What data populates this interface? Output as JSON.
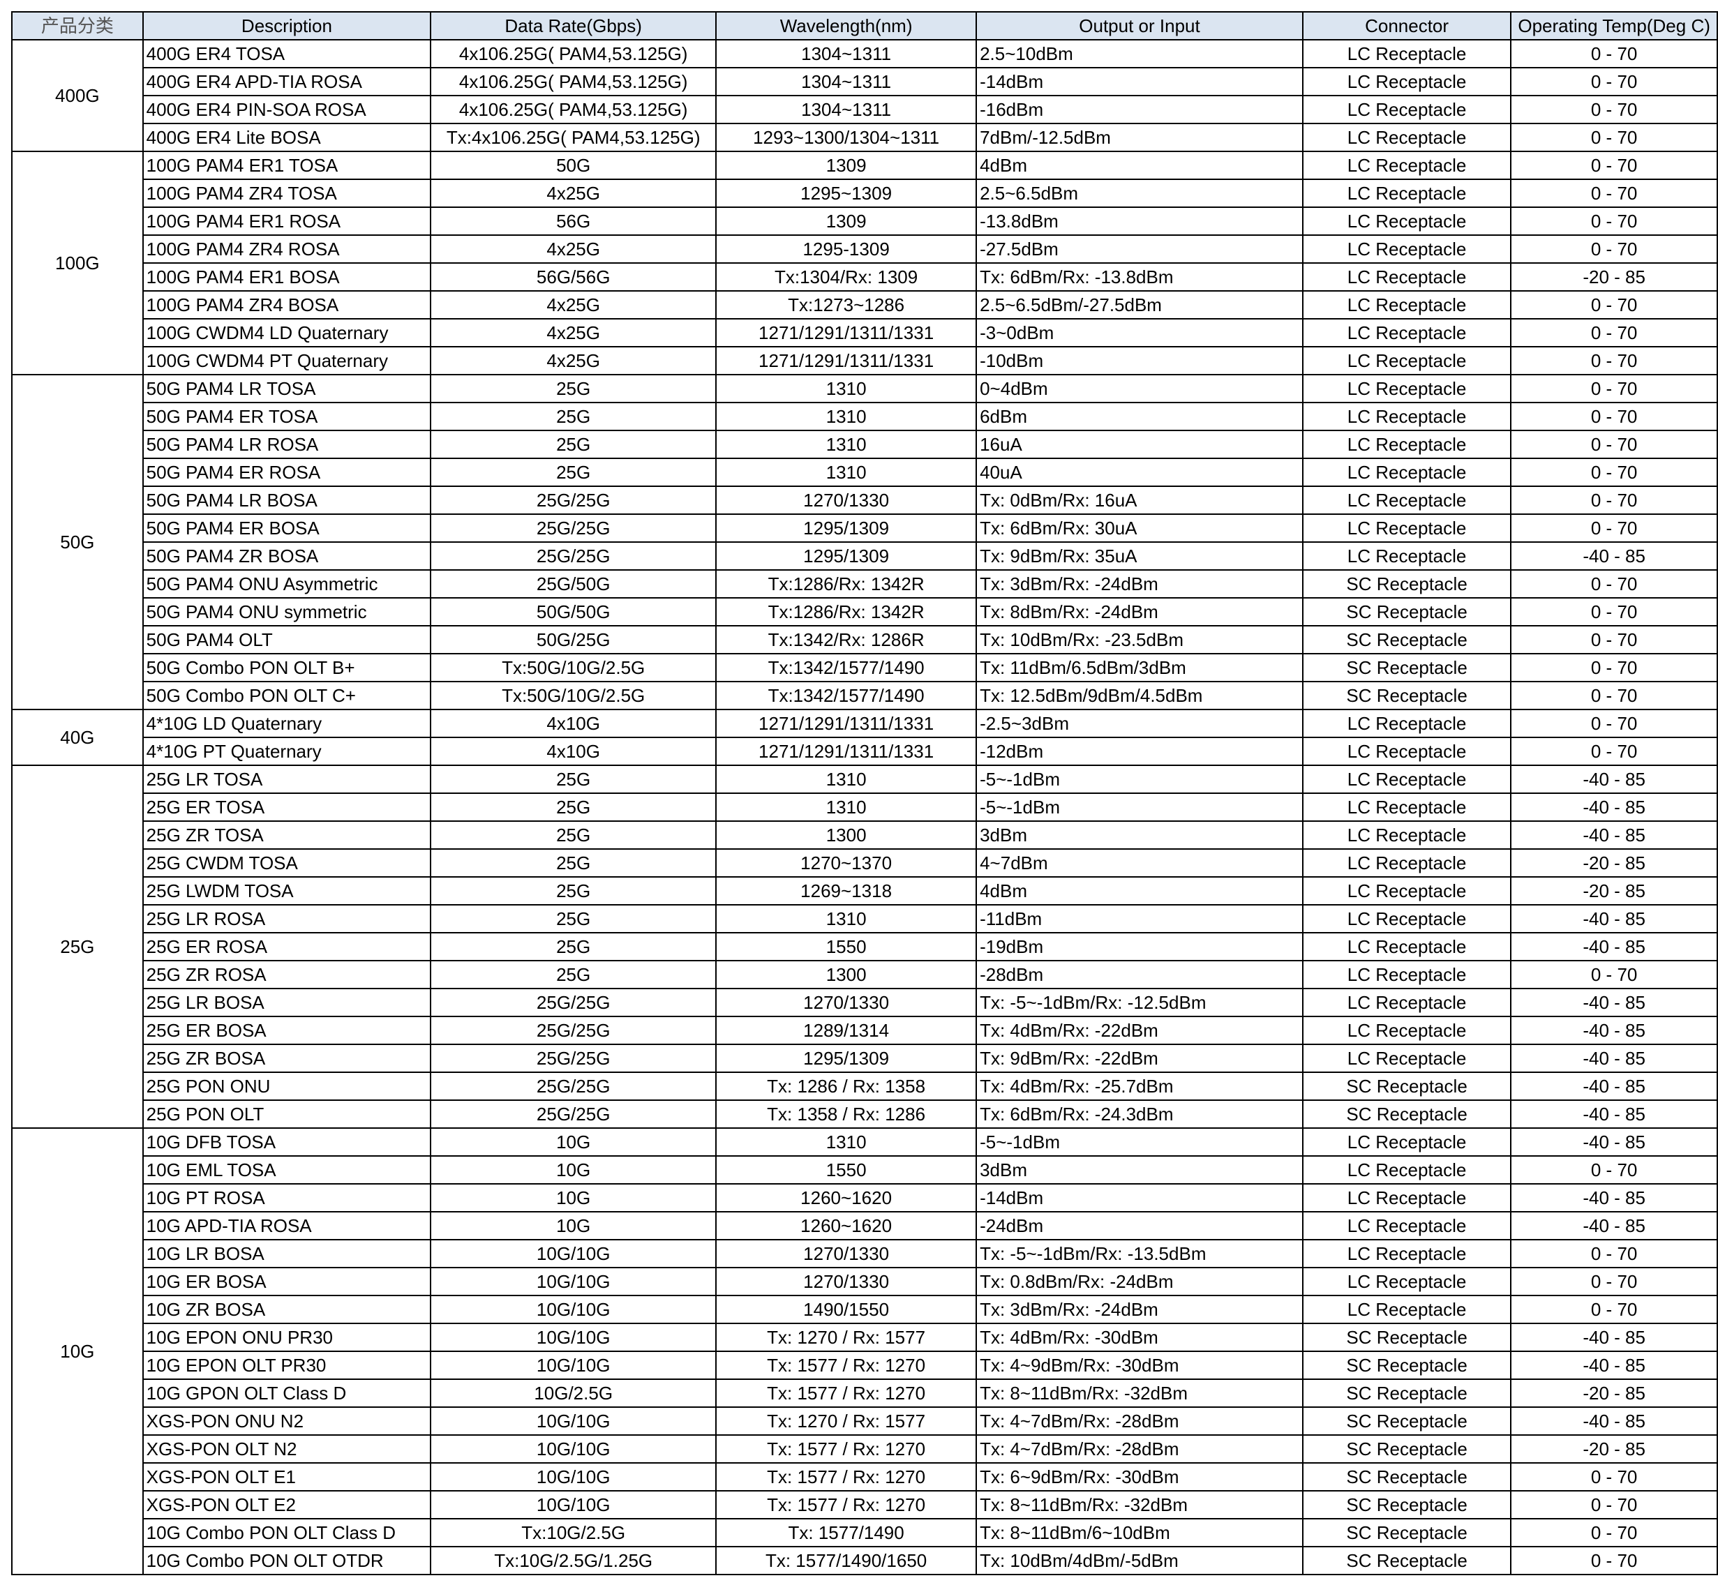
{
  "columns": [
    {
      "key": "category",
      "label": "产品分类"
    },
    {
      "key": "description",
      "label": "Description"
    },
    {
      "key": "data_rate",
      "label": "Data Rate(Gbps)"
    },
    {
      "key": "wavelength",
      "label": "Wavelength(nm)"
    },
    {
      "key": "output_input",
      "label": "Output or Input"
    },
    {
      "key": "connector",
      "label": "Connector"
    },
    {
      "key": "temp",
      "label": "Operating Temp(Deg C)"
    }
  ],
  "groups": [
    {
      "category": "400G",
      "rows": [
        [
          "400G ER4 TOSA",
          "4x106.25G( PAM4,53.125G)",
          "1304~1311",
          "2.5~10dBm",
          "LC Receptacle",
          "0 - 70"
        ],
        [
          "400G ER4 APD-TIA ROSA",
          "4x106.25G( PAM4,53.125G)",
          "1304~1311",
          "-14dBm",
          "LC Receptacle",
          "0 - 70"
        ],
        [
          "400G ER4 PIN-SOA ROSA",
          "4x106.25G( PAM4,53.125G)",
          "1304~1311",
          "-16dBm",
          "LC Receptacle",
          "0 - 70"
        ],
        [
          "400G ER4 Lite BOSA",
          "Tx:4x106.25G( PAM4,53.125G)",
          "1293~1300/1304~1311",
          "7dBm/-12.5dBm",
          "LC Receptacle",
          "0 - 70"
        ]
      ]
    },
    {
      "category": "100G",
      "rows": [
        [
          "100G PAM4 ER1 TOSA",
          "50G",
          "1309",
          "4dBm",
          "LC Receptacle",
          "0 - 70"
        ],
        [
          "100G PAM4 ZR4 TOSA",
          "4x25G",
          "1295~1309",
          "2.5~6.5dBm",
          "LC Receptacle",
          "0 - 70"
        ],
        [
          "100G PAM4 ER1 ROSA",
          "56G",
          "1309",
          "-13.8dBm",
          "LC Receptacle",
          "0 - 70"
        ],
        [
          "100G PAM4 ZR4 ROSA",
          "4x25G",
          "1295-1309",
          "-27.5dBm",
          "LC Receptacle",
          "0 - 70"
        ],
        [
          "100G PAM4 ER1 BOSA",
          "56G/56G",
          "Tx:1304/Rx: 1309",
          "Tx: 6dBm/Rx: -13.8dBm",
          "LC Receptacle",
          "-20 - 85"
        ],
        [
          "100G PAM4 ZR4 BOSA",
          "4x25G",
          "Tx:1273~1286",
          "2.5~6.5dBm/-27.5dBm",
          "LC Receptacle",
          "0 - 70"
        ],
        [
          "100G CWDM4 LD Quaternary",
          "4x25G",
          "1271/1291/1311/1331",
          "-3~0dBm",
          "LC Receptacle",
          "0 - 70"
        ],
        [
          "100G CWDM4 PT Quaternary",
          "4x25G",
          "1271/1291/1311/1331",
          "-10dBm",
          "LC Receptacle",
          "0 - 70"
        ]
      ]
    },
    {
      "category": "50G",
      "rows": [
        [
          "50G PAM4 LR TOSA",
          "25G",
          "1310",
          "0~4dBm",
          "LC Receptacle",
          "0 - 70"
        ],
        [
          "50G PAM4 ER TOSA",
          "25G",
          "1310",
          "6dBm",
          "LC Receptacle",
          "0 - 70"
        ],
        [
          "50G PAM4 LR ROSA",
          "25G",
          "1310",
          "16uA",
          "LC Receptacle",
          "0 - 70"
        ],
        [
          "50G PAM4 ER ROSA",
          "25G",
          "1310",
          "40uA",
          "LC Receptacle",
          "0 - 70"
        ],
        [
          "50G PAM4 LR BOSA",
          "25G/25G",
          "1270/1330",
          "Tx: 0dBm/Rx: 16uA",
          "LC Receptacle",
          "0 - 70"
        ],
        [
          "50G PAM4 ER BOSA",
          "25G/25G",
          "1295/1309",
          "Tx: 6dBm/Rx: 30uA",
          "LC Receptacle",
          "0 - 70"
        ],
        [
          "50G PAM4 ZR BOSA",
          "25G/25G",
          "1295/1309",
          "Tx: 9dBm/Rx: 35uA",
          "LC Receptacle",
          "-40 - 85"
        ],
        [
          "50G PAM4 ONU Asymmetric",
          "25G/50G",
          "Tx:1286/Rx: 1342R",
          "Tx: 3dBm/Rx: -24dBm",
          "SC Receptacle",
          "0 - 70"
        ],
        [
          "50G PAM4 ONU symmetric",
          "50G/50G",
          "Tx:1286/Rx: 1342R",
          "Tx: 8dBm/Rx: -24dBm",
          "SC Receptacle",
          "0 - 70"
        ],
        [
          "50G PAM4 OLT",
          "50G/25G",
          "Tx:1342/Rx: 1286R",
          "Tx: 10dBm/Rx: -23.5dBm",
          "SC Receptacle",
          "0 - 70"
        ],
        [
          "50G Combo PON OLT  B+",
          "Tx:50G/10G/2.5G",
          "Tx:1342/1577/1490",
          "Tx: 11dBm/6.5dBm/3dBm",
          "SC Receptacle",
          "0 - 70"
        ],
        [
          "50G Combo PON OLT  C+",
          "Tx:50G/10G/2.5G",
          "Tx:1342/1577/1490",
          "Tx: 12.5dBm/9dBm/4.5dBm",
          "SC Receptacle",
          "0 - 70"
        ]
      ]
    },
    {
      "category": "40G",
      "rows": [
        [
          "4*10G LD Quaternary",
          "4x10G",
          "1271/1291/1311/1331",
          "-2.5~3dBm",
          "LC Receptacle",
          "0 - 70"
        ],
        [
          "4*10G PT Quaternary",
          "4x10G",
          "1271/1291/1311/1331",
          "-12dBm",
          "LC Receptacle",
          "0 - 70"
        ]
      ]
    },
    {
      "category": "25G",
      "rows": [
        [
          "25G LR TOSA",
          "25G",
          "1310",
          "-5~-1dBm",
          "LC Receptacle",
          "-40 - 85"
        ],
        [
          "25G ER TOSA",
          "25G",
          "1310",
          "-5~-1dBm",
          "LC Receptacle",
          "-40 - 85"
        ],
        [
          "25G ZR TOSA",
          "25G",
          "1300",
          "3dBm",
          "LC Receptacle",
          "-40 - 85"
        ],
        [
          "25G CWDM TOSA",
          "25G",
          "1270~1370",
          "4~7dBm",
          "LC Receptacle",
          "-20 - 85"
        ],
        [
          "25G LWDM TOSA",
          "25G",
          "1269~1318",
          "4dBm",
          "LC Receptacle",
          "-20 - 85"
        ],
        [
          "25G LR ROSA",
          "25G",
          "1310",
          "-11dBm",
          "LC Receptacle",
          "-40 - 85"
        ],
        [
          "25G ER ROSA",
          "25G",
          "1550",
          "-19dBm",
          "LC Receptacle",
          "-40 - 85"
        ],
        [
          "25G ZR ROSA",
          "25G",
          "1300",
          "-28dBm",
          "LC Receptacle",
          "0 - 70"
        ],
        [
          "25G LR BOSA",
          "25G/25G",
          "1270/1330",
          "Tx: -5~-1dBm/Rx: -12.5dBm",
          "LC Receptacle",
          "-40 - 85"
        ],
        [
          "25G ER BOSA",
          "25G/25G",
          "1289/1314",
          "Tx: 4dBm/Rx: -22dBm",
          "LC Receptacle",
          "-40 - 85"
        ],
        [
          "25G ZR BOSA",
          "25G/25G",
          "1295/1309",
          "Tx: 9dBm/Rx: -22dBm",
          "LC Receptacle",
          "-40 - 85"
        ],
        [
          "25G PON ONU",
          "25G/25G",
          "Tx: 1286 / Rx: 1358",
          "Tx: 4dBm/Rx: -25.7dBm",
          "SC Receptacle",
          "-40 - 85"
        ],
        [
          "25G PON OLT",
          "25G/25G",
          "Tx: 1358 / Rx: 1286",
          "Tx: 6dBm/Rx: -24.3dBm",
          "SC Receptacle",
          "-40 - 85"
        ]
      ]
    },
    {
      "category": "10G",
      "rows": [
        [
          "10G DFB TOSA",
          "10G",
          "1310",
          "-5~-1dBm",
          "LC Receptacle",
          "-40 - 85"
        ],
        [
          "10G EML TOSA",
          "10G",
          "1550",
          "3dBm",
          "LC Receptacle",
          "0 - 70"
        ],
        [
          "10G PT ROSA",
          "10G",
          "1260~1620",
          "-14dBm",
          "LC Receptacle",
          "-40 - 85"
        ],
        [
          "10G APD-TIA ROSA",
          "10G",
          "1260~1620",
          "-24dBm",
          "LC Receptacle",
          "-40 - 85"
        ],
        [
          "10G LR BOSA",
          "10G/10G",
          "1270/1330",
          "Tx: -5~-1dBm/Rx: -13.5dBm",
          "LC Receptacle",
          "0 - 70"
        ],
        [
          "10G ER BOSA",
          "10G/10G",
          "1270/1330",
          "Tx: 0.8dBm/Rx: -24dBm",
          "LC Receptacle",
          "0 - 70"
        ],
        [
          "10G ZR BOSA",
          "10G/10G",
          "1490/1550",
          "Tx: 3dBm/Rx: -24dBm",
          "LC Receptacle",
          "0 - 70"
        ],
        [
          "10G EPON ONU PR30",
          "10G/10G",
          "Tx: 1270 / Rx: 1577",
          "Tx: 4dBm/Rx: -30dBm",
          "SC Receptacle",
          "-40 - 85"
        ],
        [
          "10G EPON OLT PR30",
          "10G/10G",
          "Tx: 1577 / Rx: 1270",
          "Tx: 4~9dBm/Rx: -30dBm",
          "SC Receptacle",
          "-40 - 85"
        ],
        [
          "10G GPON OLT Class D",
          "10G/2.5G",
          "Tx: 1577 / Rx: 1270",
          "Tx: 8~11dBm/Rx: -32dBm",
          "SC Receptacle",
          "-20 - 85"
        ],
        [
          "XGS-PON ONU N2",
          "10G/10G",
          "Tx: 1270 / Rx: 1577",
          "Tx: 4~7dBm/Rx: -28dBm",
          "SC Receptacle",
          "-40 - 85"
        ],
        [
          "XGS-PON OLT N2",
          "10G/10G",
          "Tx: 1577 / Rx: 1270",
          "Tx: 4~7dBm/Rx: -28dBm",
          "SC Receptacle",
          "-20 - 85"
        ],
        [
          "XGS-PON OLT E1",
          "10G/10G",
          "Tx: 1577 / Rx: 1270",
          "Tx: 6~9dBm/Rx: -30dBm",
          "SC Receptacle",
          "0 - 70"
        ],
        [
          "XGS-PON OLT E2",
          "10G/10G",
          "Tx: 1577 / Rx: 1270",
          "Tx: 8~11dBm/Rx: -32dBm",
          "SC Receptacle",
          "0 - 70"
        ],
        [
          "10G Combo PON OLT Class D",
          "Tx:10G/2.5G",
          "Tx:  1577/1490",
          "Tx: 8~11dBm/6~10dBm",
          "SC Receptacle",
          "0 - 70"
        ],
        [
          "10G Combo PON OLT OTDR",
          "Tx:10G/2.5G/1.25G",
          "Tx:  1577/1490/1650",
          "Tx: 10dBm/4dBm/-5dBm",
          "SC Receptacle",
          "0 - 70"
        ]
      ]
    }
  ],
  "colors": {
    "header_bg": "#dbe5f1",
    "border": "#000000"
  }
}
